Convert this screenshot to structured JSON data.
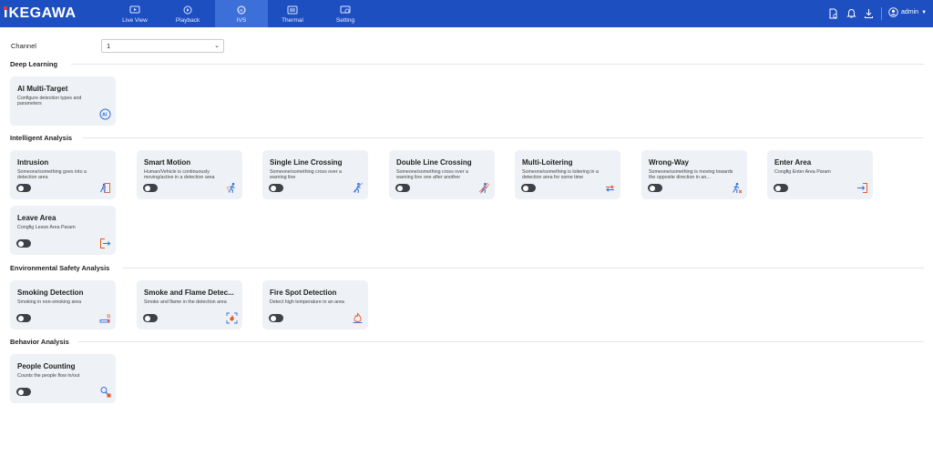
{
  "header": {
    "logo_text": "KEGAWA",
    "logo_prefix": "I",
    "brand_color": "#1d4fc1",
    "tabs": [
      {
        "label": "Live View",
        "icon": "live-view-icon"
      },
      {
        "label": "Playback",
        "icon": "playback-icon"
      },
      {
        "label": "IVS",
        "icon": "ai-icon",
        "active": true
      },
      {
        "label": "Thermal",
        "icon": "thermal-icon"
      },
      {
        "label": "Setting",
        "icon": "setting-icon"
      }
    ],
    "user": "admin"
  },
  "channel": {
    "label": "Channel",
    "value": "1"
  },
  "sections": [
    {
      "title": "Deep Learning",
      "cards": [
        {
          "title": "AI Multi-Target",
          "desc": "Configure detection types and parameters",
          "icon": "ai-chip-icon",
          "has_toggle": false
        }
      ]
    },
    {
      "title": "Intelligent Analysis",
      "cards": [
        {
          "title": "Intrusion",
          "desc": "Someone/something goes into a detection area",
          "icon": "intrusion-icon",
          "has_toggle": true
        },
        {
          "title": "Smart Motion",
          "desc": "Human/Vehicle is continuously moving/active in a detection area",
          "icon": "smart-motion-icon",
          "has_toggle": true
        },
        {
          "title": "Single Line Crossing",
          "desc": "Someone/something cross over a warning line",
          "icon": "line-crossing-icon",
          "has_toggle": true
        },
        {
          "title": "Double Line Crossing",
          "desc": "Someone/something cross over a warning line one after another",
          "icon": "double-line-crossing-icon",
          "has_toggle": true
        },
        {
          "title": "Multi-Loitering",
          "desc": "Someone/something is loitering in a detection area for some time",
          "icon": "loitering-icon",
          "has_toggle": true
        },
        {
          "title": "Wrong-Way",
          "desc": "Someone/something is moving towards the opposite direction in an...",
          "icon": "wrong-way-icon",
          "has_toggle": true
        },
        {
          "title": "Enter Area",
          "desc": "Congfig Enter Area Param",
          "icon": "enter-area-icon",
          "has_toggle": true
        },
        {
          "title": "Leave Area",
          "desc": "Congfig Leave Area Param",
          "icon": "leave-area-icon",
          "has_toggle": true
        }
      ]
    },
    {
      "title": "Environmental Safety Analysis",
      "cards": [
        {
          "title": "Smoking Detection",
          "desc": "Smoking in non-smoking area",
          "icon": "smoking-icon",
          "has_toggle": true
        },
        {
          "title": "Smoke and Flame Detec...",
          "desc": "Smoke and flame in the detection area",
          "icon": "smoke-flame-icon",
          "has_toggle": true
        },
        {
          "title": "Fire Spot Detection",
          "desc": "Detect high temperature in an area",
          "icon": "fire-spot-icon",
          "has_toggle": true
        }
      ]
    },
    {
      "title": "Behavior Analysis",
      "cards": [
        {
          "title": "People Counting",
          "desc": "Counts the people flow in/out",
          "icon": "people-counting-icon",
          "has_toggle": true
        }
      ]
    }
  ]
}
